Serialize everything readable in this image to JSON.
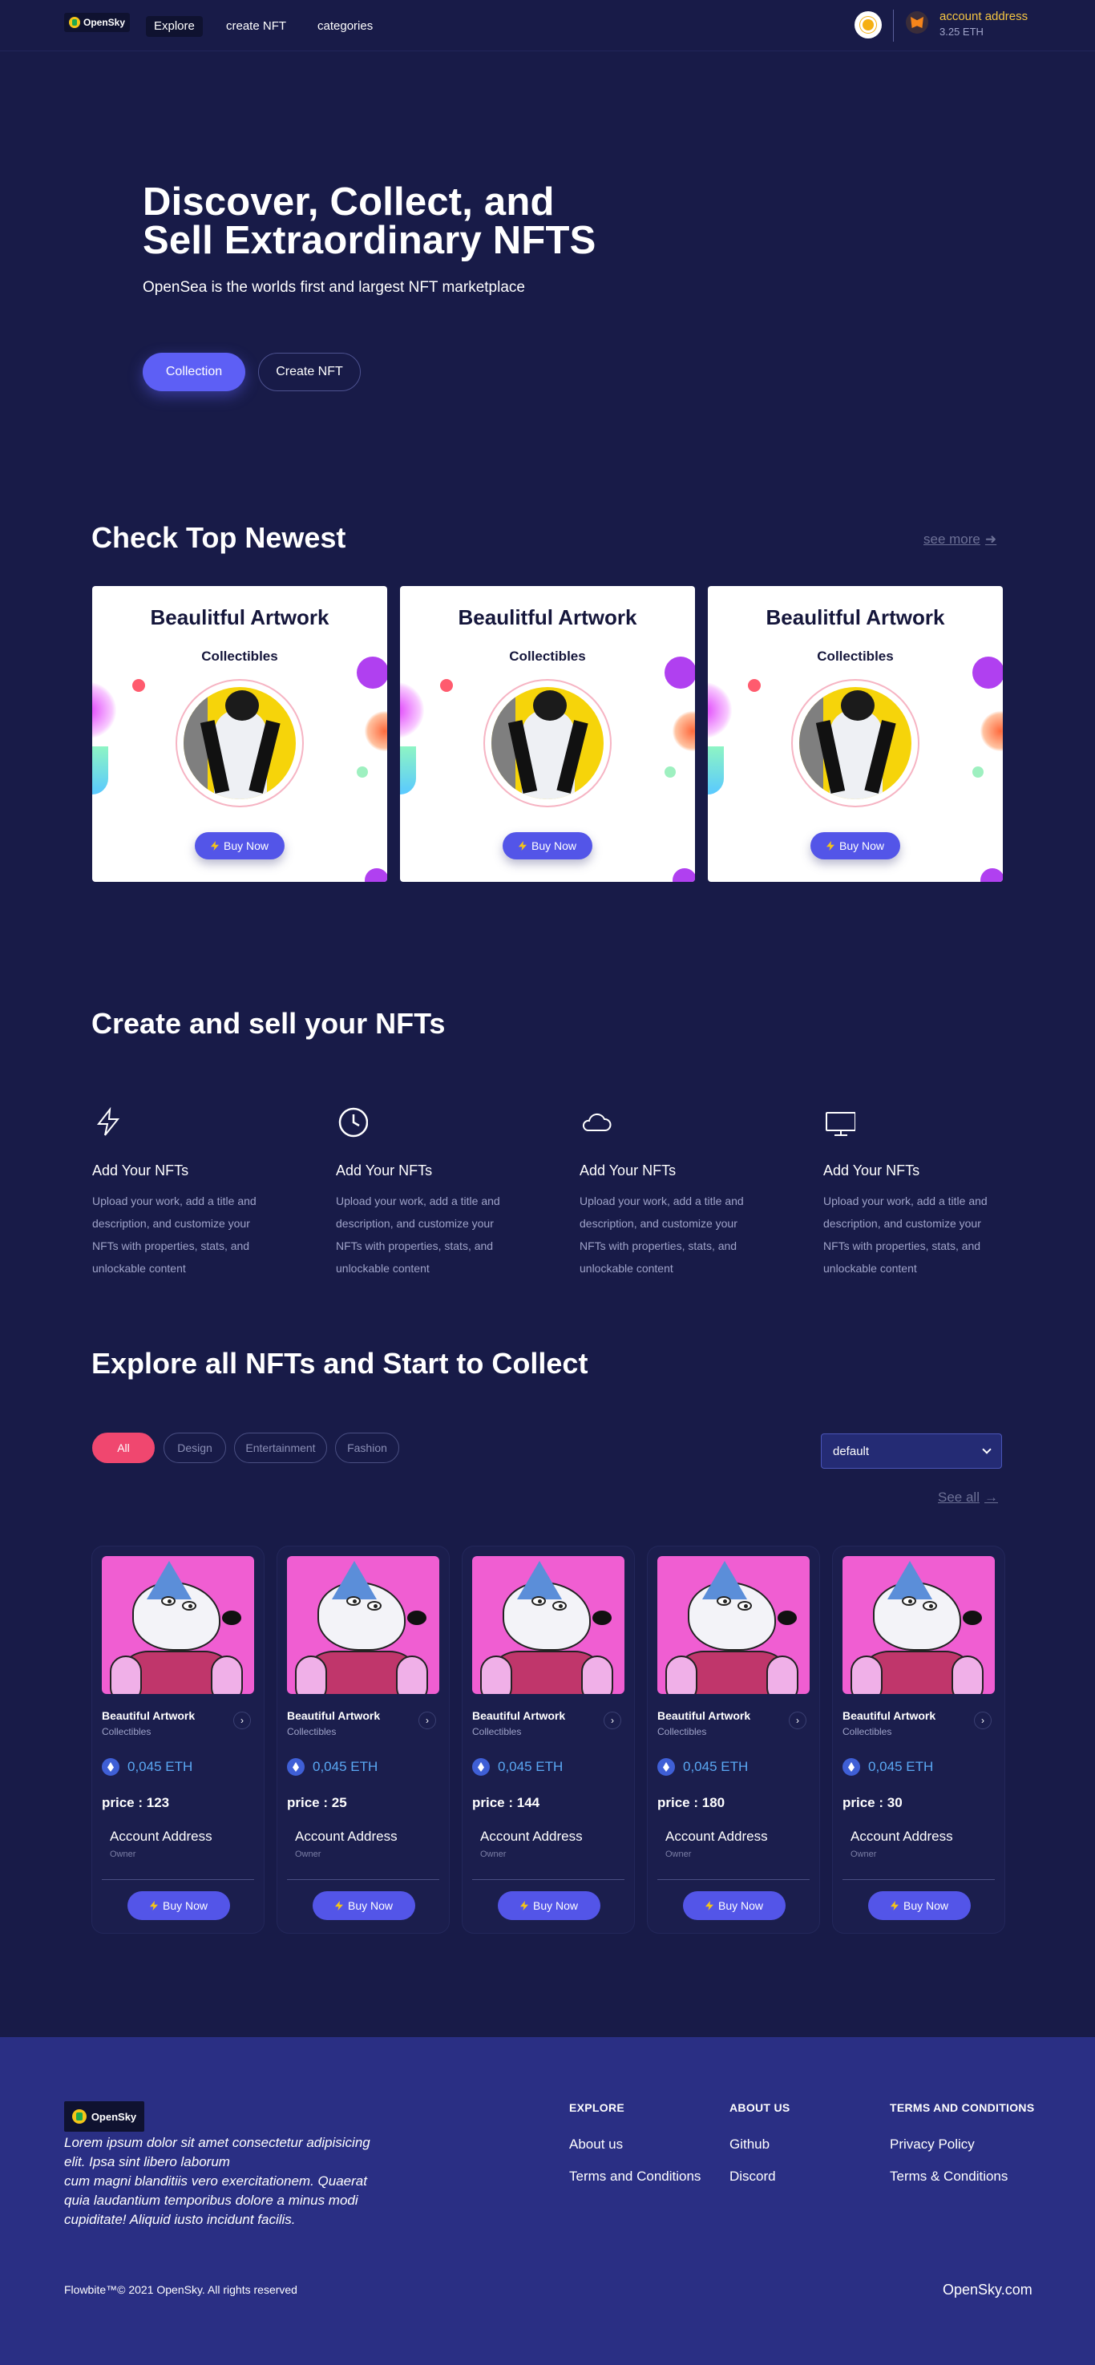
{
  "nav": {
    "logo": "OpenSky",
    "links": [
      "Explore",
      "create NFT",
      "categories"
    ],
    "account_name": "account address",
    "account_eth": "3.25 ETH"
  },
  "hero": {
    "title_line1": "Discover, Collect, and",
    "title_line2": "Sell Extraordinary NFTS",
    "subtitle": "OpenSea is the worlds first and largest NFT marketplace",
    "btn_collection": "Collection",
    "btn_create": "Create NFT"
  },
  "top_newest": {
    "heading": "Check Top Newest",
    "see_more": "see more",
    "cards": [
      {
        "title": "Beaulitful Artwork",
        "subtitle": "Collectibles",
        "button": "Buy Now"
      },
      {
        "title": "Beaulitful Artwork",
        "subtitle": "Collectibles",
        "button": "Buy Now"
      },
      {
        "title": "Beaulitful Artwork",
        "subtitle": "Collectibles",
        "button": "Buy Now"
      }
    ]
  },
  "create_sell": {
    "heading": "Create and sell your NFTs",
    "features": [
      {
        "icon": "lightning-icon",
        "title": "Add Your NFTs",
        "desc": "Upload your work, add a title and description, and customize your NFTs with properties, stats, and unlockable content"
      },
      {
        "icon": "clock-icon",
        "title": "Add Your NFTs",
        "desc": "Upload your work, add a title and description, and customize your NFTs with properties, stats, and unlockable content"
      },
      {
        "icon": "cloud-icon",
        "title": "Add Your NFTs",
        "desc": "Upload your work, add a title and description, and customize your NFTs with properties, stats, and unlockable content"
      },
      {
        "icon": "monitor-icon",
        "title": "Add Your NFTs",
        "desc": "Upload your work, add a title and description, and customize your NFTs with properties, stats, and unlockable content"
      }
    ]
  },
  "explore": {
    "heading": "Explore all NFTs and Start to Collect",
    "filters": [
      "All",
      "Design",
      "Entertainment",
      "Fashion"
    ],
    "sort_value": "default",
    "see_all": "See all",
    "cards": [
      {
        "title": "Beautiful Artwork",
        "subtitle": "Collectibles",
        "eth": "0,045 ETH",
        "price": "price : 123",
        "account": "Account Address",
        "owner": "Owner",
        "button": "Buy Now"
      },
      {
        "title": "Beautiful Artwork",
        "subtitle": "Collectibles",
        "eth": "0,045 ETH",
        "price": "price : 25",
        "account": "Account Address",
        "owner": "Owner",
        "button": "Buy Now"
      },
      {
        "title": "Beautiful Artwork",
        "subtitle": "Collectibles",
        "eth": "0,045 ETH",
        "price": "price : 144",
        "account": "Account Address",
        "owner": "Owner",
        "button": "Buy Now"
      },
      {
        "title": "Beautiful Artwork",
        "subtitle": "Collectibles",
        "eth": "0,045 ETH",
        "price": "price : 180",
        "account": "Account Address",
        "owner": "Owner",
        "button": "Buy Now"
      },
      {
        "title": "Beautiful Artwork",
        "subtitle": "Collectibles",
        "eth": "0,045 ETH",
        "price": "price : 30",
        "account": "Account Address",
        "owner": "Owner",
        "button": "Buy Now"
      }
    ]
  },
  "footer": {
    "logo": "OpenSky",
    "desc_lines": [
      "Lorem ipsum dolor sit amet consectetur adipisicing",
      "elit. Ipsa sint libero laborum",
      "cum magni blanditiis vero exercitationem. Quaerat",
      "quia laudantium temporibus dolore a minus modi",
      "cupiditate! Aliquid iusto incidunt facilis."
    ],
    "columns": [
      {
        "heading": "EXPLORE",
        "links": [
          "About us",
          "Terms and Conditions"
        ]
      },
      {
        "heading": "ABOUT US",
        "links": [
          "Github",
          "Discord"
        ]
      },
      {
        "heading": "TERMS AND CONDITIONS",
        "links": [
          "Privacy Policy",
          "Terms & Conditions"
        ]
      }
    ],
    "copyright": "Flowbite™© 2021 OpenSky. All rights reserved",
    "site": "OpenSky.com"
  },
  "colors": {
    "background": "#181b48",
    "accent": "#5d5ff5",
    "chip_active": "#f0476f",
    "footer": "#2a2f84",
    "eth": "#5aa8f4"
  }
}
